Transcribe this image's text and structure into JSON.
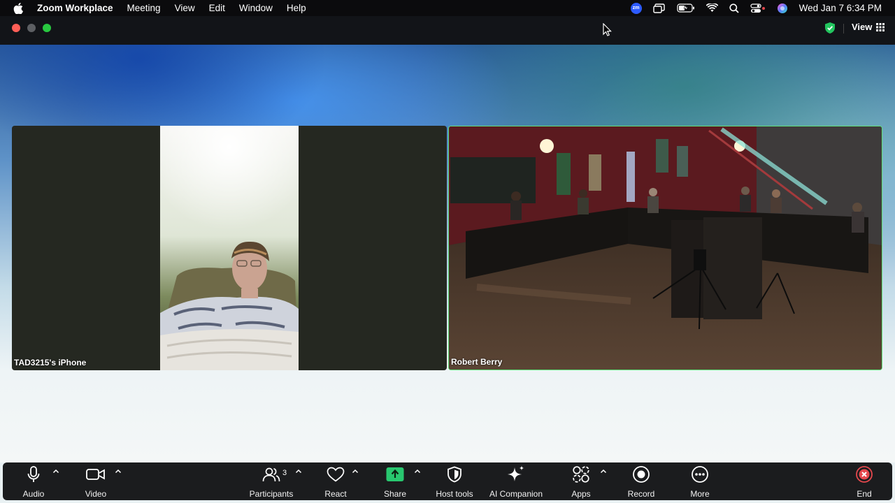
{
  "menubar": {
    "app": "Zoom Workplace",
    "items": [
      "Meeting",
      "View",
      "Edit",
      "Window",
      "Help"
    ],
    "zoom_badge": "zm",
    "clock": "Wed Jan 7  6:34 PM"
  },
  "window": {
    "view_label": "View"
  },
  "participants": [
    {
      "name": "TAD3215's iPhone"
    },
    {
      "name": "Robert Berry",
      "active_speaker": true
    }
  ],
  "toolbar": {
    "audio": "Audio",
    "video": "Video",
    "participants": "Participants",
    "participants_count": "3",
    "react": "React",
    "share": "Share",
    "host_tools": "Host tools",
    "ai_companion": "AI Companion",
    "apps": "Apps",
    "record": "Record",
    "more": "More",
    "end": "End"
  },
  "colors": {
    "share_accent": "#28c76f",
    "active_border": "#5fe07a",
    "end_red": "#e5484d"
  }
}
